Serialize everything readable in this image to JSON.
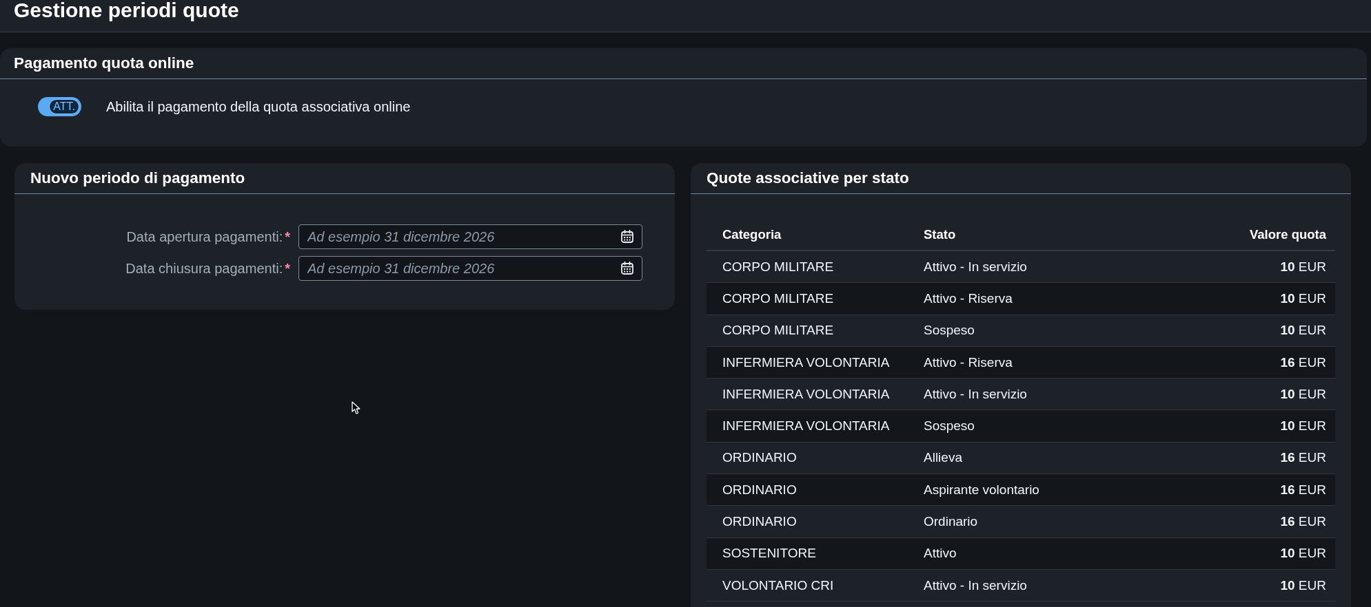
{
  "page": {
    "title": "Gestione periodi quote"
  },
  "online_payment": {
    "title": "Pagamento quota online",
    "toggle": {
      "on": true,
      "label": "ATT."
    },
    "description": "Abilita il pagamento della quota associativa online"
  },
  "new_period": {
    "title": "Nuovo periodo di pagamento",
    "fields": [
      {
        "label": "Data apertura pagamenti:",
        "required_mark": "*",
        "placeholder": "Ad esempio 31 dicembre 2026"
      },
      {
        "label": "Data chiusura pagamenti:",
        "required_mark": "*",
        "placeholder": "Ad esempio 31 dicembre 2026"
      }
    ]
  },
  "fees": {
    "title": "Quote associative per stato",
    "columns": [
      "Categoria",
      "Stato",
      "Valore quota"
    ],
    "rows": [
      {
        "categoria": "CORPO MILITARE",
        "stato": "Attivo - In servizio",
        "valore_quota": "**10** EUR"
      },
      {
        "categoria": "CORPO MILITARE",
        "stato": "Attivo - Riserva",
        "valore_quota": "**10** EUR"
      },
      {
        "categoria": "CORPO MILITARE",
        "stato": "Sospeso",
        "valore_quota": "**10** EUR"
      },
      {
        "categoria": "INFERMIERA VOLONTARIA",
        "stato": "Attivo - Riserva",
        "valore_quota": "**16** EUR"
      },
      {
        "categoria": "INFERMIERA VOLONTARIA",
        "stato": "Attivo - In servizio",
        "valore_quota": "**10** EUR"
      },
      {
        "categoria": "INFERMIERA VOLONTARIA",
        "stato": "Sospeso",
        "valore_quota": "**10** EUR"
      },
      {
        "categoria": "ORDINARIO",
        "stato": "Allieva",
        "valore_quota": "**16** EUR"
      },
      {
        "categoria": "ORDINARIO",
        "stato": "Aspirante volontario",
        "valore_quota": "**16** EUR"
      },
      {
        "categoria": "ORDINARIO",
        "stato": "Ordinario",
        "valore_quota": "**16** EUR"
      },
      {
        "categoria": "SOSTENITORE",
        "stato": "Attivo",
        "valore_quota": "**10** EUR"
      },
      {
        "categoria": "VOLONTARIO CRI",
        "stato": "Attivo - In servizio",
        "valore_quota": "**10** EUR"
      }
    ]
  }
}
